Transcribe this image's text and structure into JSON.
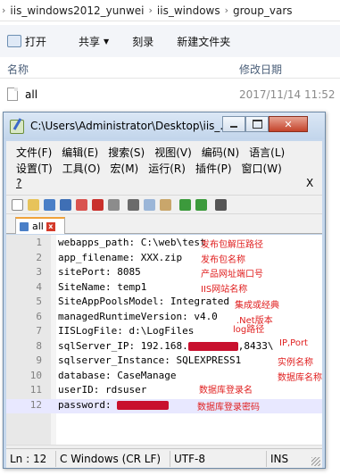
{
  "explorer": {
    "breadcrumb": [
      "iis_windows2012_yunwei",
      "iis_windows",
      "group_vars"
    ],
    "toolbar": {
      "open": "打开",
      "share": "共享",
      "burn": "刻录",
      "new_folder": "新建文件夹"
    },
    "columns": {
      "name": "名称",
      "date": "修改日期"
    },
    "files": [
      {
        "name": "all",
        "date": "2017/11/14 11:52"
      }
    ]
  },
  "notepad": {
    "title": "C:\\Users\\Administrator\\Desktop\\iis_...",
    "menus_row1": [
      {
        "label": "文件(F)"
      },
      {
        "label": "编辑(E)"
      },
      {
        "label": "搜索(S)"
      },
      {
        "label": "视图(V)"
      },
      {
        "label": "编码(N)"
      },
      {
        "label": "语言(L)"
      }
    ],
    "menus_row2": [
      {
        "label": "设置(T)"
      },
      {
        "label": "工具(O)"
      },
      {
        "label": "宏(M)"
      },
      {
        "label": "运行(R)"
      },
      {
        "label": "插件(P)"
      },
      {
        "label": "窗口(W)"
      }
    ],
    "menu_help": "?",
    "menu_close": "X",
    "tab": {
      "name": "all"
    },
    "lines": [
      {
        "num": "1",
        "text": "webapps_path: C:\\web\\test",
        "note": "发布包解压路径"
      },
      {
        "num": "2",
        "text": "app_filename: XXX.zip",
        "note": "发布包名称"
      },
      {
        "num": "3",
        "text": "sitePort: 8085",
        "note": "产品网址端口号"
      },
      {
        "num": "4",
        "text": "SiteName: temp1",
        "note": "IIS网站名称"
      },
      {
        "num": "5",
        "text": "SiteAppPoolsModel: Integrated",
        "note": "集成或经典"
      },
      {
        "num": "6",
        "text": "managedRuntimeVersion: v4.0",
        "note": ".Net版本"
      },
      {
        "num": "7",
        "text": "IISLogFile: d:\\LogFiles",
        "note": "log路径"
      },
      {
        "num": "8",
        "text_before": "sqlServer_IP: 192.168.",
        "text_after": ",8433\\",
        "note": "IP,Port"
      },
      {
        "num": "9",
        "text": "sqlserver_Instance: SQLEXPRESS1",
        "note": "实例名称"
      },
      {
        "num": "10",
        "text": "database: CaseManage",
        "note": "数据库名称"
      },
      {
        "num": "11",
        "text": "userID: rdsuser",
        "note": "数据库登录名"
      },
      {
        "num": "12",
        "text_before": "password: ",
        "text_after": "",
        "note": "数据库登录密码"
      }
    ],
    "status": {
      "position": "Ln : 12",
      "eol": "C Windows (CR LF)",
      "encoding": "UTF-8",
      "mode": "INS"
    },
    "colors": {
      "annotation": "#e02020",
      "redaction": "#c8102e",
      "tab_accent": "#f0a23a"
    }
  }
}
